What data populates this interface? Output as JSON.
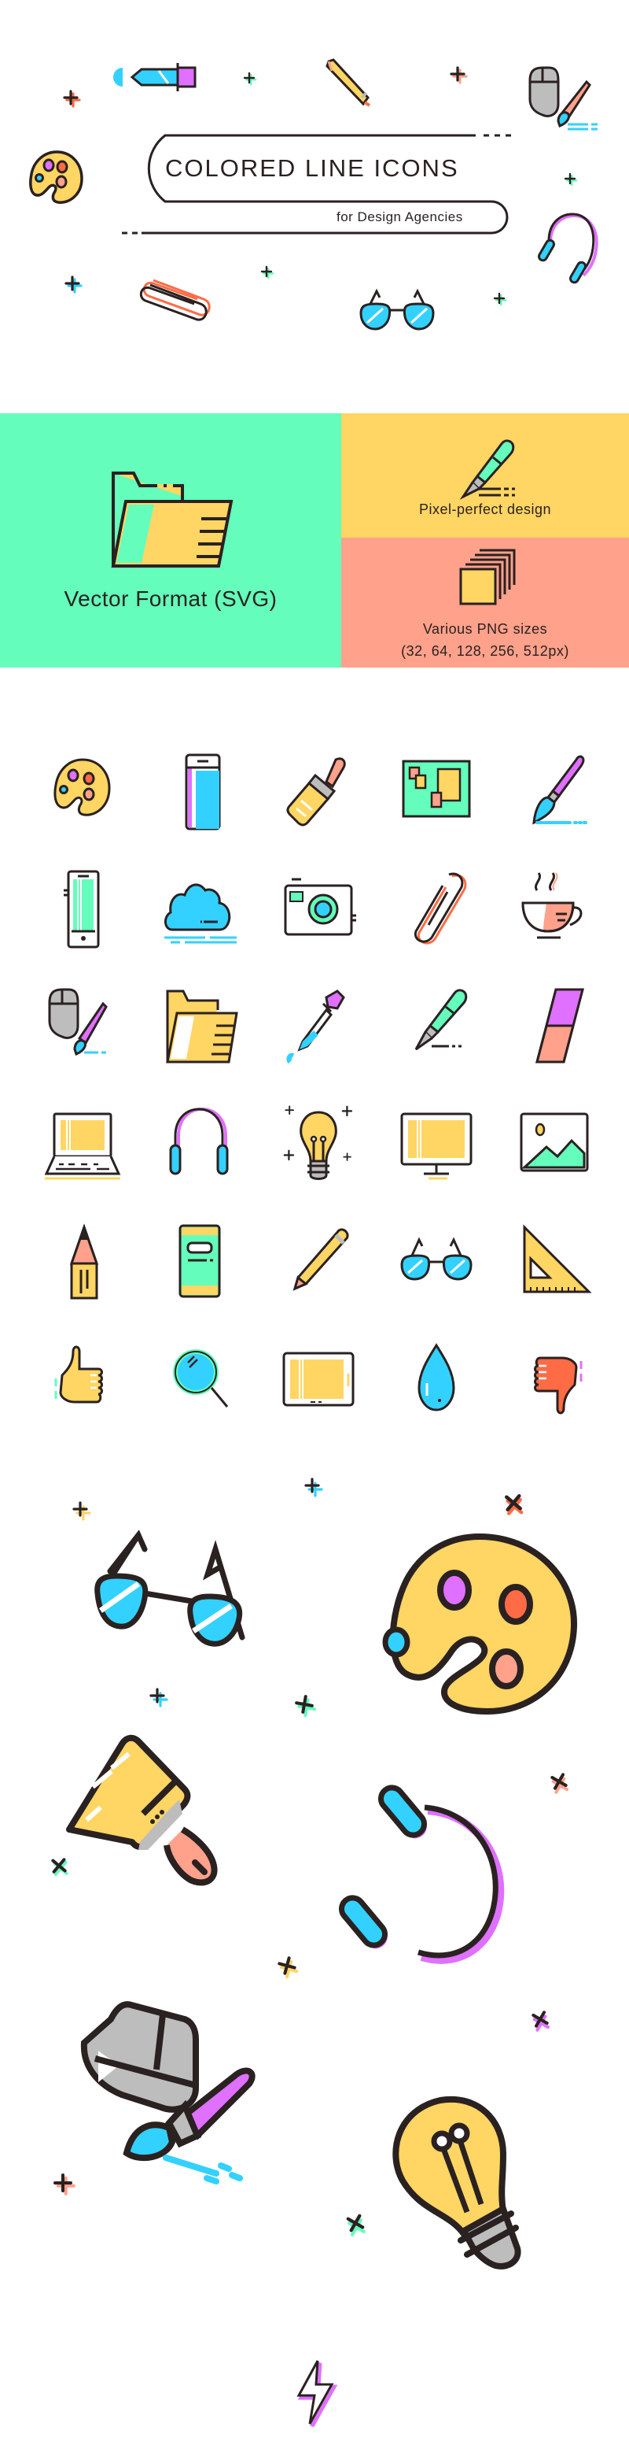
{
  "hero": {
    "title": "COLORED LINE ICONS",
    "subtitle": "for Design Agencies"
  },
  "features": {
    "vector": {
      "label": "Vector Format (SVG)",
      "icon": "folder-icon",
      "bg_color": "#64fdbb"
    },
    "pixel": {
      "label": "Pixel-perfect design",
      "icon": "fountain-pen-icon",
      "bg_color": "#ffd563"
    },
    "png": {
      "label_line1": "Various PNG sizes",
      "label_line2": "(32, 64, 128, 256, 512px)",
      "icon": "stacked-pages-icon",
      "bg_color": "#ffa18b"
    }
  },
  "palette": {
    "outline": "#2a2121",
    "mint": "#64fdbb",
    "yellow": "#ffd563",
    "salmon": "#ffa18b",
    "orange": "#ff6b45",
    "blue": "#33d1ff",
    "violet": "#e070ff",
    "gray": "#bdbdbd"
  },
  "icon_grid": [
    [
      "palette-icon",
      "book-icon",
      "paint-brush-icon",
      "mood-board-icon",
      "art-brush-icon"
    ],
    [
      "smartphone-icon",
      "cloud-icon",
      "camera-icon",
      "paperclip-icon",
      "coffee-cup-icon"
    ],
    [
      "mouse-brush-icon",
      "folder-icon",
      "dropper-icon",
      "fountain-pen-icon",
      "eraser-icon"
    ],
    [
      "laptop-icon",
      "headphones-icon",
      "light-bulb-icon",
      "monitor-icon",
      "image-icon"
    ],
    [
      "pencil-tip-icon",
      "notebook-icon",
      "pencil-icon",
      "glasses-icon",
      "triangle-ruler-icon"
    ],
    [
      "thumbs-up-icon",
      "magnifier-icon",
      "tablet-icon",
      "water-drop-icon",
      "thumbs-down-icon"
    ]
  ],
  "large_icons": [
    "glasses-icon",
    "palette-icon",
    "paint-brush-icon",
    "headphones-icon",
    "mouse-brush-icon",
    "light-bulb-icon",
    "lightning-icon"
  ]
}
